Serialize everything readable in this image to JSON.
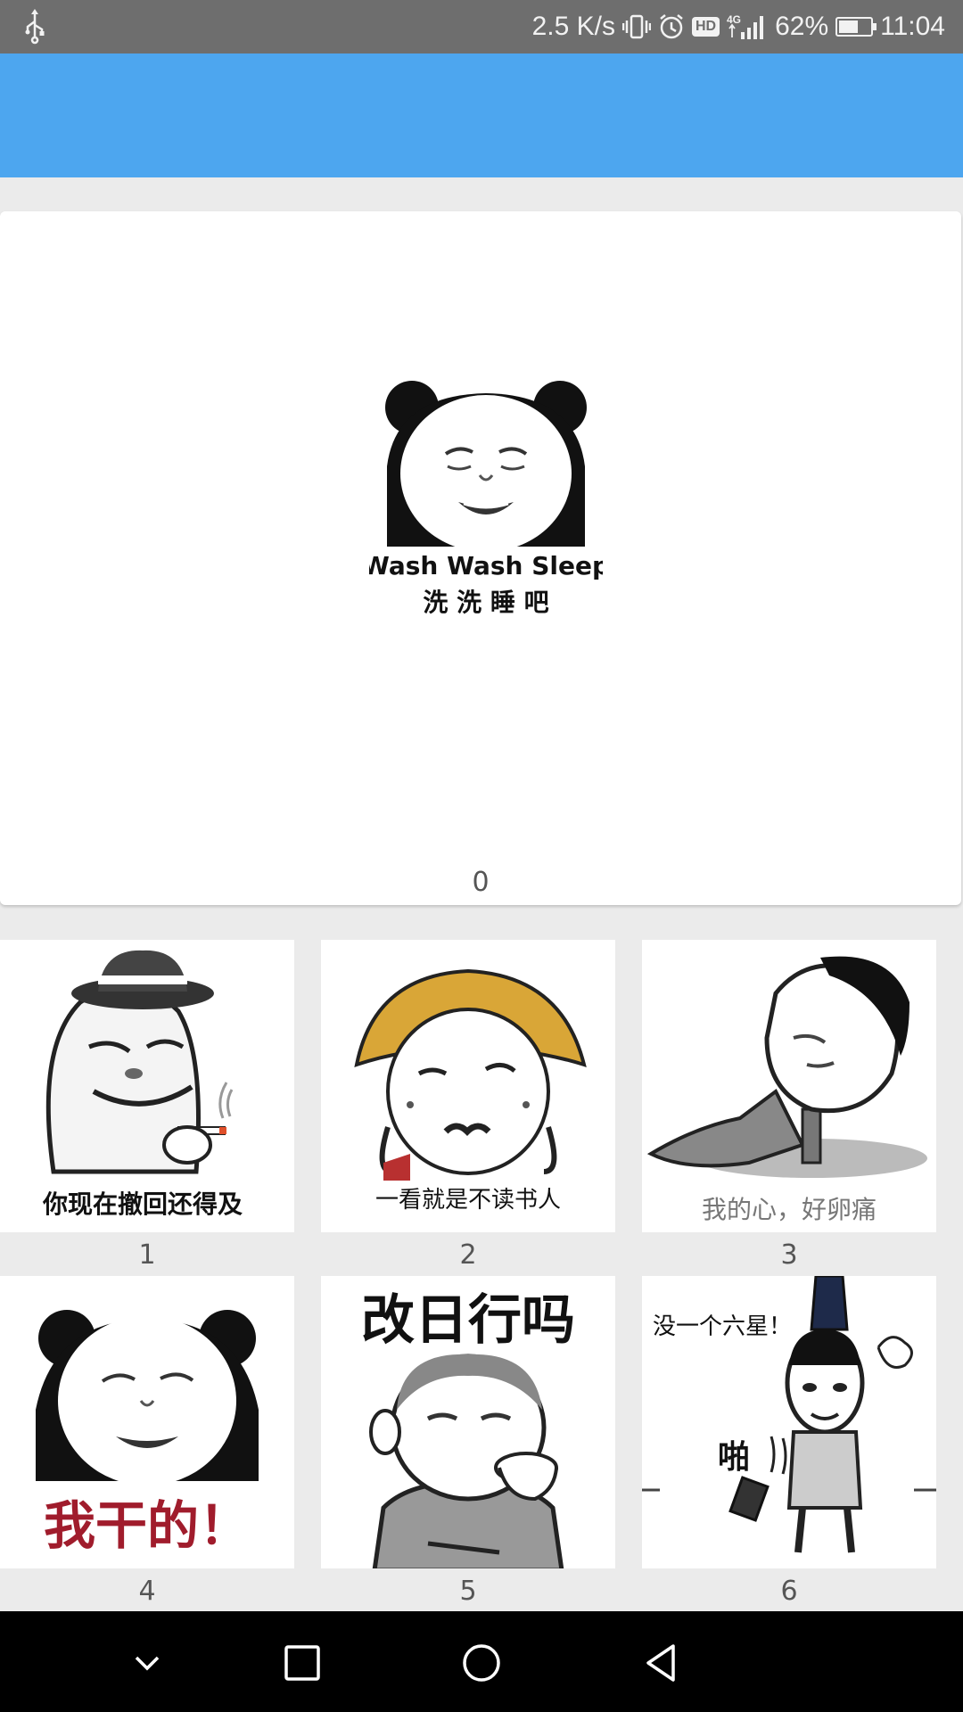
{
  "status_bar": {
    "net_speed": "2.5 K/s",
    "hd_badge": "HD",
    "network": "4G",
    "battery_percent": "62%",
    "battery_level": 0.62,
    "time": "11:04",
    "icons": [
      "usb-icon",
      "vibrate-icon",
      "alarm-icon",
      "hd-icon",
      "signal-icon",
      "battery-charging-icon"
    ]
  },
  "app_bar": {
    "color": "#4da6ef"
  },
  "featured": {
    "index_label": "0",
    "caption_en": "Wash Wash Sleep",
    "caption_zh": "洗 洗 睡 吧"
  },
  "tiles": [
    {
      "index_label": "1",
      "caption": "你现在撤回还得及"
    },
    {
      "index_label": "2",
      "caption": "一看就是不读书人"
    },
    {
      "index_label": "3",
      "caption": "我的心，好卵痛"
    },
    {
      "index_label": "4",
      "caption": "我干的！"
    },
    {
      "index_label": "5",
      "caption": "改日行吗"
    },
    {
      "index_label": "6",
      "caption": "没一个六星！",
      "sfx": "啪"
    }
  ],
  "nav_bar": {
    "icons": [
      "nav-down-icon",
      "nav-recent-icon",
      "nav-home-icon",
      "nav-back-icon"
    ]
  }
}
